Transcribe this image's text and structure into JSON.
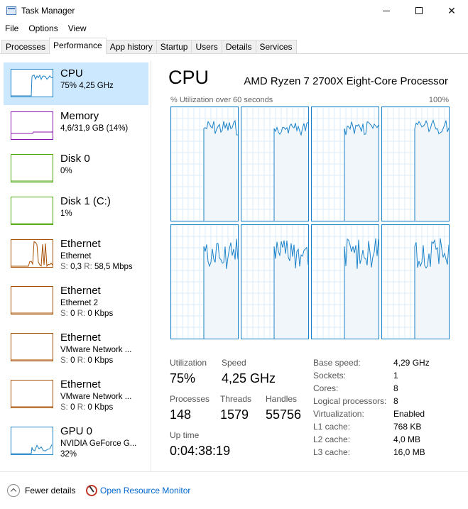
{
  "window": {
    "title": "Task Manager"
  },
  "menu": [
    "File",
    "Options",
    "View"
  ],
  "tabs": [
    "Processes",
    "Performance",
    "App history",
    "Startup",
    "Users",
    "Details",
    "Services"
  ],
  "active_tab": "Performance",
  "sidebar": {
    "items": [
      {
        "name": "CPU",
        "sub": "75% 4,25 GHz",
        "sub2": "",
        "color": "#1b83c9",
        "selected": true
      },
      {
        "name": "Memory",
        "sub": "4,6/31,9 GB (14%)",
        "sub2": "",
        "color": "#8b12ae"
      },
      {
        "name": "Disk 0",
        "sub": "0%",
        "sub2": "",
        "color": "#4da60c"
      },
      {
        "name": "Disk 1 (C:)",
        "sub": "1%",
        "sub2": "",
        "color": "#4da60c"
      },
      {
        "name": "Ethernet",
        "sub": "Ethernet",
        "sub2_s": "S:",
        "sub2_sv": "0,3",
        "sub2_r": "R:",
        "sub2_rv": "58,5 Mbps",
        "color": "#a74f01"
      },
      {
        "name": "Ethernet",
        "sub": "Ethernet 2",
        "sub2_s": "S:",
        "sub2_sv": "0",
        "sub2_r": "R:",
        "sub2_rv": "0 Kbps",
        "color": "#a74f01"
      },
      {
        "name": "Ethernet",
        "sub": "VMware Network ...",
        "sub2_s": "S:",
        "sub2_sv": "0",
        "sub2_r": "R:",
        "sub2_rv": "0 Kbps",
        "color": "#a74f01"
      },
      {
        "name": "Ethernet",
        "sub": "VMware Network ...",
        "sub2_s": "S:",
        "sub2_sv": "0",
        "sub2_r": "R:",
        "sub2_rv": "0 Kbps",
        "color": "#a74f01"
      },
      {
        "name": "GPU 0",
        "sub": "NVIDIA GeForce G...",
        "sub2": "32%",
        "color": "#1b83c9"
      }
    ]
  },
  "main": {
    "heading": "CPU",
    "processor": "AMD Ryzen 7 2700X Eight-Core Processor",
    "graph_label": "% Utilization over 60 seconds",
    "graph_max": "100%",
    "core_count": 8,
    "stats": {
      "utilization_label": "Utilization",
      "utilization": "75%",
      "speed_label": "Speed",
      "speed": "4,25 GHz",
      "processes_label": "Processes",
      "processes": "148",
      "threads_label": "Threads",
      "threads": "1579",
      "handles_label": "Handles",
      "handles": "55756",
      "uptime_label": "Up time",
      "uptime": "0:04:38:19"
    },
    "specs": [
      {
        "k": "Base speed:",
        "v": "4,29 GHz"
      },
      {
        "k": "Sockets:",
        "v": "1"
      },
      {
        "k": "Cores:",
        "v": "8"
      },
      {
        "k": "Logical processors:",
        "v": "8"
      },
      {
        "k": "Virtualization:",
        "v": "Enabled"
      },
      {
        "k": "L1 cache:",
        "v": "768 KB"
      },
      {
        "k": "L2 cache:",
        "v": "4,0 MB"
      },
      {
        "k": "L3 cache:",
        "v": "16,0 MB"
      }
    ]
  },
  "footer": {
    "fewer_details": "Fewer details",
    "resource_monitor": "Open Resource Monitor"
  }
}
